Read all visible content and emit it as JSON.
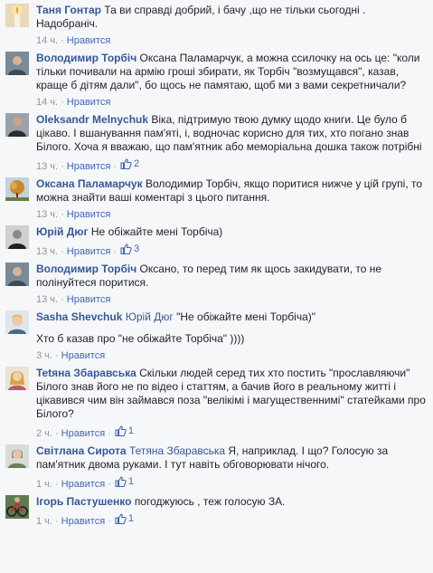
{
  "comments": [
    {
      "author": "Таня Гонтар",
      "text": "Та ви справді добрий, і бачу ,що не тільки сьогодні . Надобраніч.",
      "time": "14 ч.",
      "like_label": "Нравится",
      "avatar": "candle-avatar"
    },
    {
      "author": "Володимир Торбіч",
      "text": "Оксана Паламарчук, а можна ссилочку на ось це: \"коли тільки почивали на армію гроші збирати, як Торбіч \"возмущався\", казав, краще б дітям дали\", бо щось не памятаю, щоб ми з вами секретничали?",
      "time": "14 ч.",
      "like_label": "Нравится",
      "avatar": "man-avatar"
    },
    {
      "author": "Oleksandr Melnychuk",
      "text": "Віка, підтримую твою думку щодо книги. Це було б цікаво. І вшанування пам'яті, і, водночас корисно для тих, хто погано знав Білого. Хоча я вважаю, що пам'ятник або меморіальна дошка також потрібні",
      "time": "13 ч.",
      "like_label": "Нравится",
      "likes": "2",
      "avatar": "man-dark-avatar"
    },
    {
      "author": "Оксана Паламарчук",
      "text": "Володимир Торбіч, якщо поритися нижче у цій групі, то можна знайти ваші коментарі з цього питання.",
      "time": "13 ч.",
      "like_label": "Нравится",
      "avatar": "tree-avatar"
    },
    {
      "author": "Юрій Дюг",
      "text": "Не обіжайте мені Торбіча)",
      "time": "13 ч.",
      "like_label": "Нравится",
      "likes": "3",
      "avatar": "man-bw-avatar"
    },
    {
      "author": "Володимир Торбіч",
      "text": "Оксано, то перед тим як щось закидувати, то не полінуйтеся поритися.",
      "time": "13 ч.",
      "like_label": "Нравится",
      "avatar": "man-avatar"
    },
    {
      "author": "Sasha Shevchuk",
      "mention": "Юрій Дюг",
      "text": "\"Не обіжайте мені Торбіча)\"",
      "text2": "Хто б казав про \"не обіжайте Торбіча\" ))))",
      "time": "3 ч.",
      "like_label": "Нравится",
      "avatar": "blond-avatar"
    },
    {
      "author": "Tetяна Збаравська",
      "text": "Скільки людей серед тих хто постить \"прославляючи\" Білого знав його не по відео і статтям, а бачив його в реальному житті і цікавився чим він займався поза \"велікімі і магущественнимі\" статейками про Білого?",
      "time": "2 ч.",
      "like_label": "Нравится",
      "likes": "1",
      "avatar": "woman-avatar"
    },
    {
      "author": "Світлана Сирота",
      "mention": "Тетяна Збаравська",
      "text": "Я, наприклад. І що? Голосую за пам'ятник двома руками. І тут навіть обговорювати нічого.",
      "time": "1 ч.",
      "like_label": "Нравится",
      "likes": "1",
      "avatar": "woman-gray-avatar"
    },
    {
      "author": "Ігорь Пастушенко",
      "text": "погоджуюсь , теж голосую ЗА.",
      "time": "1 ч.",
      "like_label": "Нравится",
      "likes": "1",
      "avatar": "bike-avatar"
    }
  ]
}
